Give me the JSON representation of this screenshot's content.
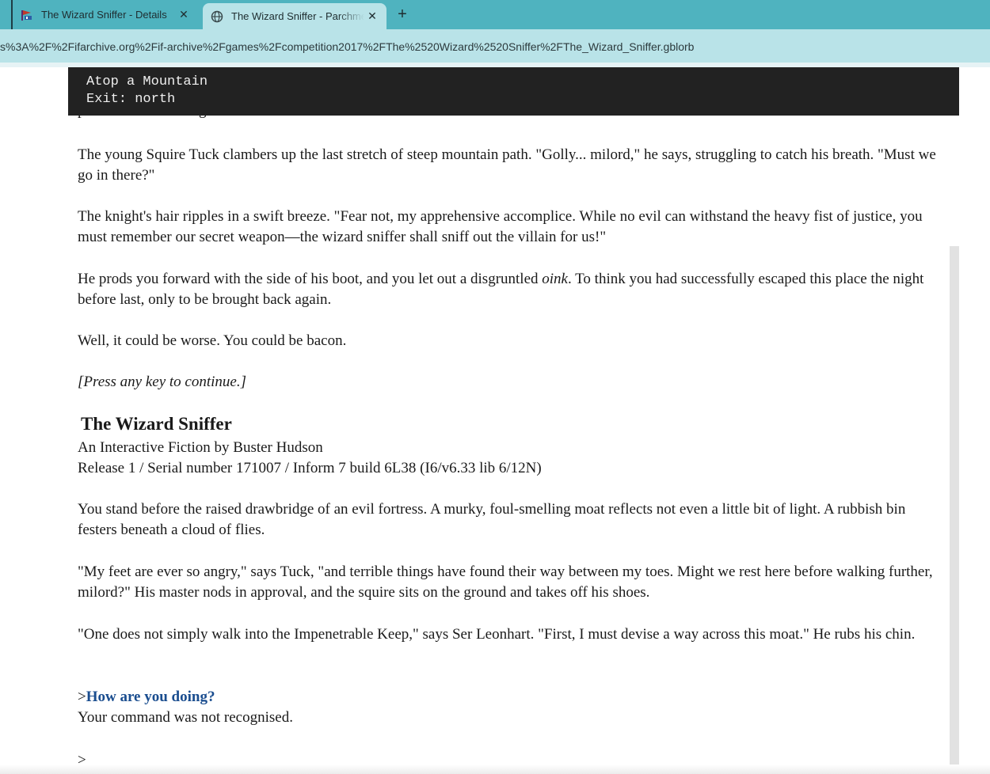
{
  "browser": {
    "tabs": [
      {
        "title": "The Wizard Sniffer - Details",
        "icon": "ship-flag-icon",
        "active": false
      },
      {
        "title": "The Wizard Sniffer - Parchment",
        "icon": "globe-icon",
        "active": true
      }
    ],
    "new_tab_label": "+",
    "close_glyph": "✕",
    "url": "s%3A%2F%2Fifarchive.org%2Fif-archive%2Fgames%2Fcompetition2017%2FThe%2520Wizard%2520Sniffer%2FThe_Wizard_Sniffer.gblorb",
    "colors": {
      "tabbar": "#4fb3bf",
      "active_tab": "#b9e3e8",
      "command": "#1a4d8f"
    }
  },
  "game": {
    "status": {
      "location": "Atop a Mountain",
      "exits": "Exit: north"
    },
    "clipped_line": "peace to our fair kingdom.",
    "paragraphs": {
      "p1": "The young Squire Tuck clambers up the last stretch of steep mountain path. \"Golly... milord,\" he says, struggling to catch his breath. \"Must we go in there?\"",
      "p2": "The knight's hair ripples in a swift breeze. \"Fear not, my apprehensive accomplice. While no evil can withstand the heavy fist of justice, you must remember our secret weapon—the wizard sniffer shall sniff out the villain for us!\"",
      "p3_before": "He prods you forward with the side of his boot, and you let out a disgruntled ",
      "p3_em": "oink",
      "p3_after": ". To think you had successfully escaped this place the night before last, only to be brought back again.",
      "p4": "Well, it could be worse. You could be bacon.",
      "p5": "[Press any key to continue.]"
    },
    "banner": {
      "title": "The Wizard Sniffer",
      "byline": "An Interactive Fiction by Buster Hudson",
      "release": "Release 1 / Serial number 171007 / Inform 7 build 6L38 (I6/v6.33 lib 6/12N)"
    },
    "room": {
      "description": "You stand before the raised drawbridge of an evil fortress. A murky, foul-smelling moat reflects not even a little bit of light. A rubbish bin festers beneath a cloud of flies.",
      "tuck": "\"My feet are ever so angry,\" says Tuck, \"and terrible things have found their way between my toes. Might we rest here before walking further, milord?\" His master nods in approval, and the squire sits on the ground and takes off his shoes.",
      "leonhart": "\"One does not simply walk into the Impenetrable Keep,\" says Ser Leonhart. \"First, I must devise a way across this moat.\" He rubs his chin."
    },
    "prompt": ">",
    "command": "How are you doing?",
    "response": "Your command was not recognised.",
    "input_prompt": ">"
  }
}
